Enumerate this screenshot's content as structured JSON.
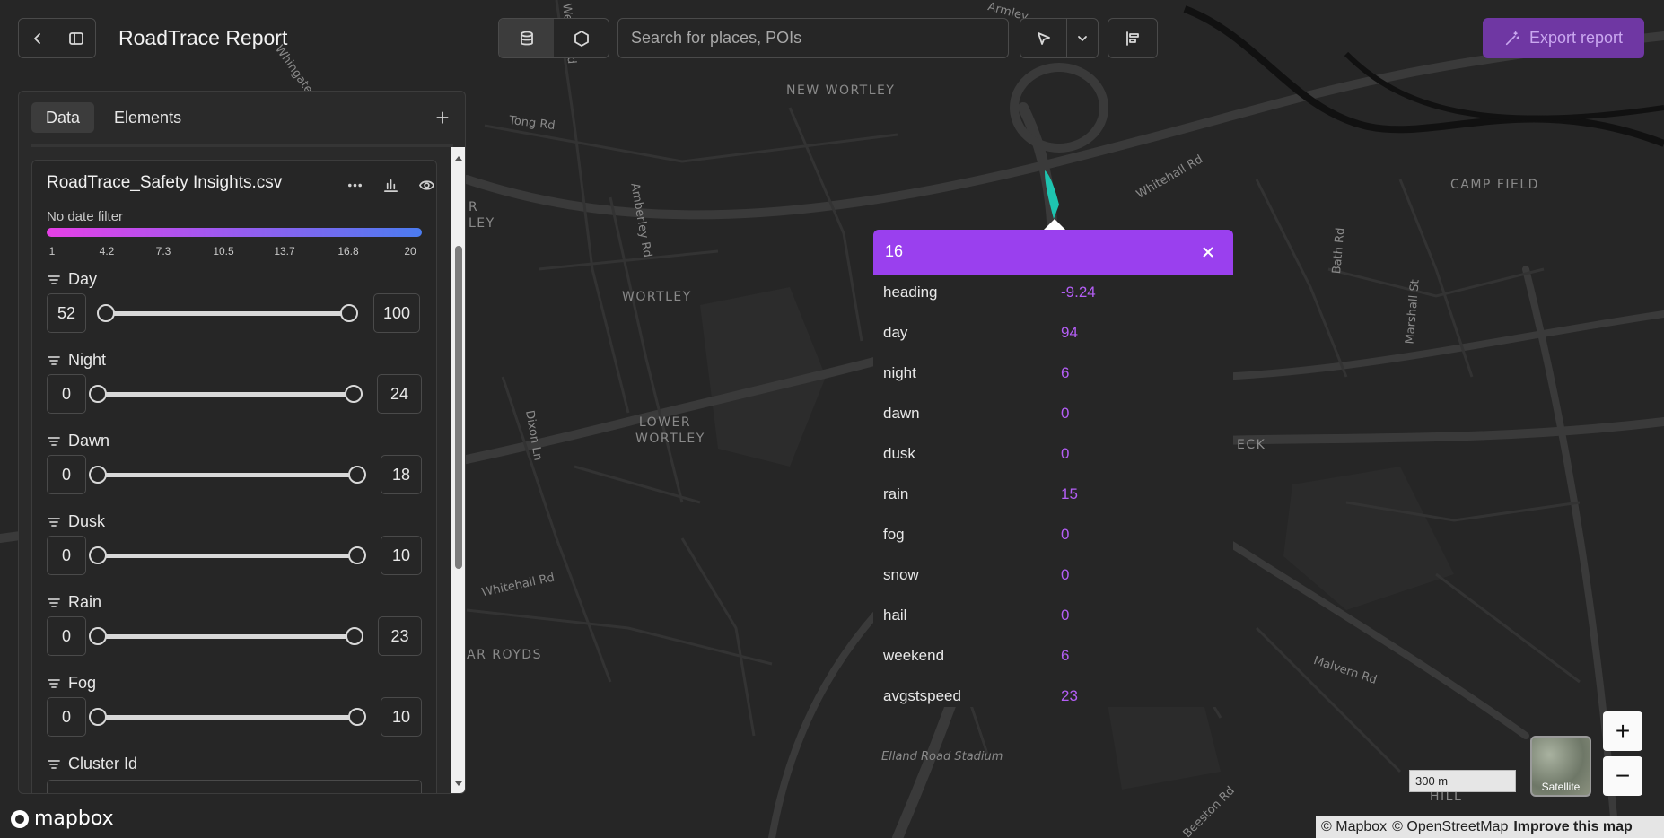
{
  "header": {
    "title": "RoadTrace Report",
    "search_placeholder": "Search for places, POIs",
    "export_label": "Export report"
  },
  "panel": {
    "tabs": [
      {
        "label": "Data",
        "active": true
      },
      {
        "label": "Elements",
        "active": false
      }
    ],
    "add_label": "+",
    "layer": {
      "name": "RoadTrace_Safety Insights.csv",
      "date_filter": "No date filter",
      "gradient_ticks": [
        "1",
        "4.2",
        "7.3",
        "10.5",
        "13.7",
        "16.8",
        "20"
      ],
      "gradient_colors": [
        "#e640e6",
        "#a058f0",
        "#4b7cf0"
      ],
      "filters": [
        {
          "label": "Day",
          "min": "52",
          "max": "100"
        },
        {
          "label": "Night",
          "min": "0",
          "max": "24"
        },
        {
          "label": "Dawn",
          "min": "0",
          "max": "18"
        },
        {
          "label": "Dusk",
          "min": "0",
          "max": "10"
        },
        {
          "label": "Rain",
          "min": "0",
          "max": "23"
        },
        {
          "label": "Fog",
          "min": "0",
          "max": "10"
        },
        {
          "label": "Cluster Id",
          "min": "",
          "max": ""
        }
      ]
    }
  },
  "popup": {
    "title": "16",
    "header_color": "#9a40ee",
    "rows": [
      {
        "key": "heading",
        "value": "-9.24"
      },
      {
        "key": "day",
        "value": "94"
      },
      {
        "key": "night",
        "value": "6"
      },
      {
        "key": "dawn",
        "value": "0"
      },
      {
        "key": "dusk",
        "value": "0"
      },
      {
        "key": "rain",
        "value": "15"
      },
      {
        "key": "fog",
        "value": "0"
      },
      {
        "key": "snow",
        "value": "0"
      },
      {
        "key": "hail",
        "value": "0"
      },
      {
        "key": "weekend",
        "value": "6"
      },
      {
        "key": "avgstspeed",
        "value": "23"
      }
    ]
  },
  "map": {
    "places": [
      "NEW WORTLEY",
      "WORTLEY",
      "LOWER WORTLEY",
      "CAMP FIELD",
      "ECK",
      "AR ROYDS",
      "R LEY",
      "HILL",
      "Elland Road Stadium"
    ],
    "roads": [
      "Tong Rd",
      "Whitehall Rd",
      "Whitehall Rd",
      "Amberley Rd",
      "Dixon Ln",
      "Bath Rd",
      "Marshall St",
      "Malvern Rd",
      "Beeston Rd",
      "Armley",
      "Wesley Rd",
      "Whingate"
    ],
    "marker_color": "#1ec4b0"
  },
  "controls": {
    "scale_label": "300 m",
    "satellite_label": "Satellite",
    "zoom_in": "+",
    "zoom_out": "−",
    "logo_text": "mapbox",
    "attribution": [
      "© Mapbox",
      "© OpenStreetMap",
      "Improve this map"
    ]
  }
}
